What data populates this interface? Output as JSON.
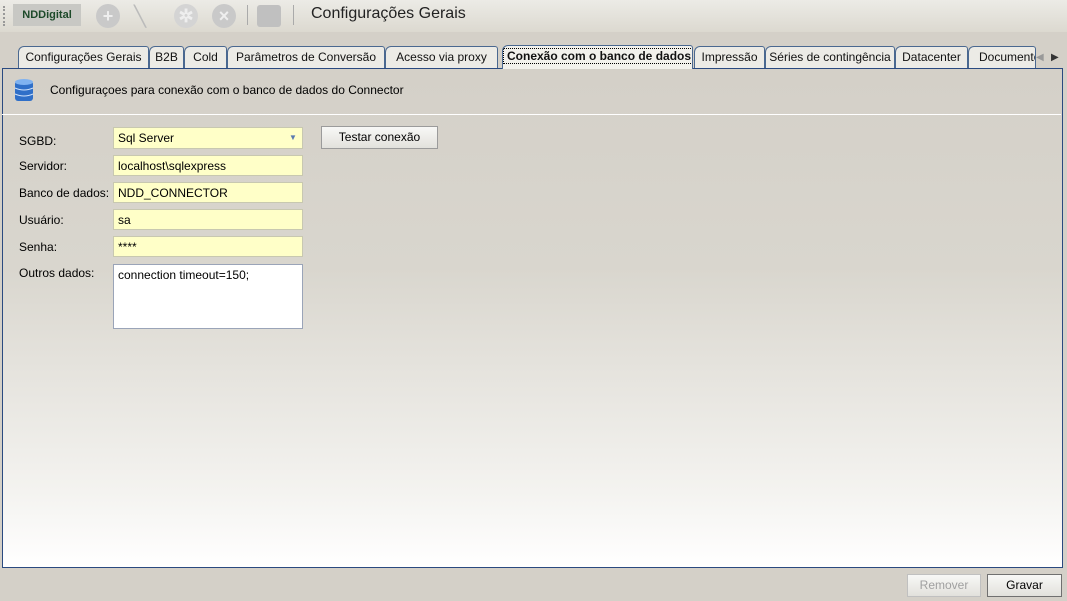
{
  "toolbar": {
    "logo": "NDDigital",
    "title": "Configurações Gerais",
    "icons": [
      "add-icon",
      "edit-icon",
      "settings-icon",
      "cancel-icon",
      "export-icon"
    ]
  },
  "tabs": [
    {
      "label": "Configurações Gerais"
    },
    {
      "label": "B2B"
    },
    {
      "label": "Cold"
    },
    {
      "label": "Parâmetros de Conversão"
    },
    {
      "label": "Acesso via proxy"
    },
    {
      "label": "Conexão com o banco de dados",
      "active": true
    },
    {
      "label": "Impressão"
    },
    {
      "label": "Séries de contingência"
    },
    {
      "label": "Datacenter"
    },
    {
      "label": "Documentos"
    }
  ],
  "header": {
    "text": "Configuraçoes para conexão com o banco de dados do Connector",
    "icon": "database-icon"
  },
  "form": {
    "sgbd": {
      "label": "SGBD:",
      "value": "Sql Server"
    },
    "servidor": {
      "label": "Servidor:",
      "value": "localhost\\sqlexpress"
    },
    "banco": {
      "label": "Banco de dados:",
      "value": "NDD_CONNECTOR"
    },
    "usuario": {
      "label": "Usuário:",
      "value": "sa"
    },
    "senha": {
      "label": "Senha:",
      "value": "****"
    },
    "outros": {
      "label": "Outros dados:",
      "value": "connection timeout=150;"
    },
    "test_button": "Testar conexão"
  },
  "footer": {
    "remove": "Remover",
    "save": "Gravar"
  },
  "colors": {
    "field_bg": "#ffffc8",
    "tab_border": "#2a4a80"
  }
}
